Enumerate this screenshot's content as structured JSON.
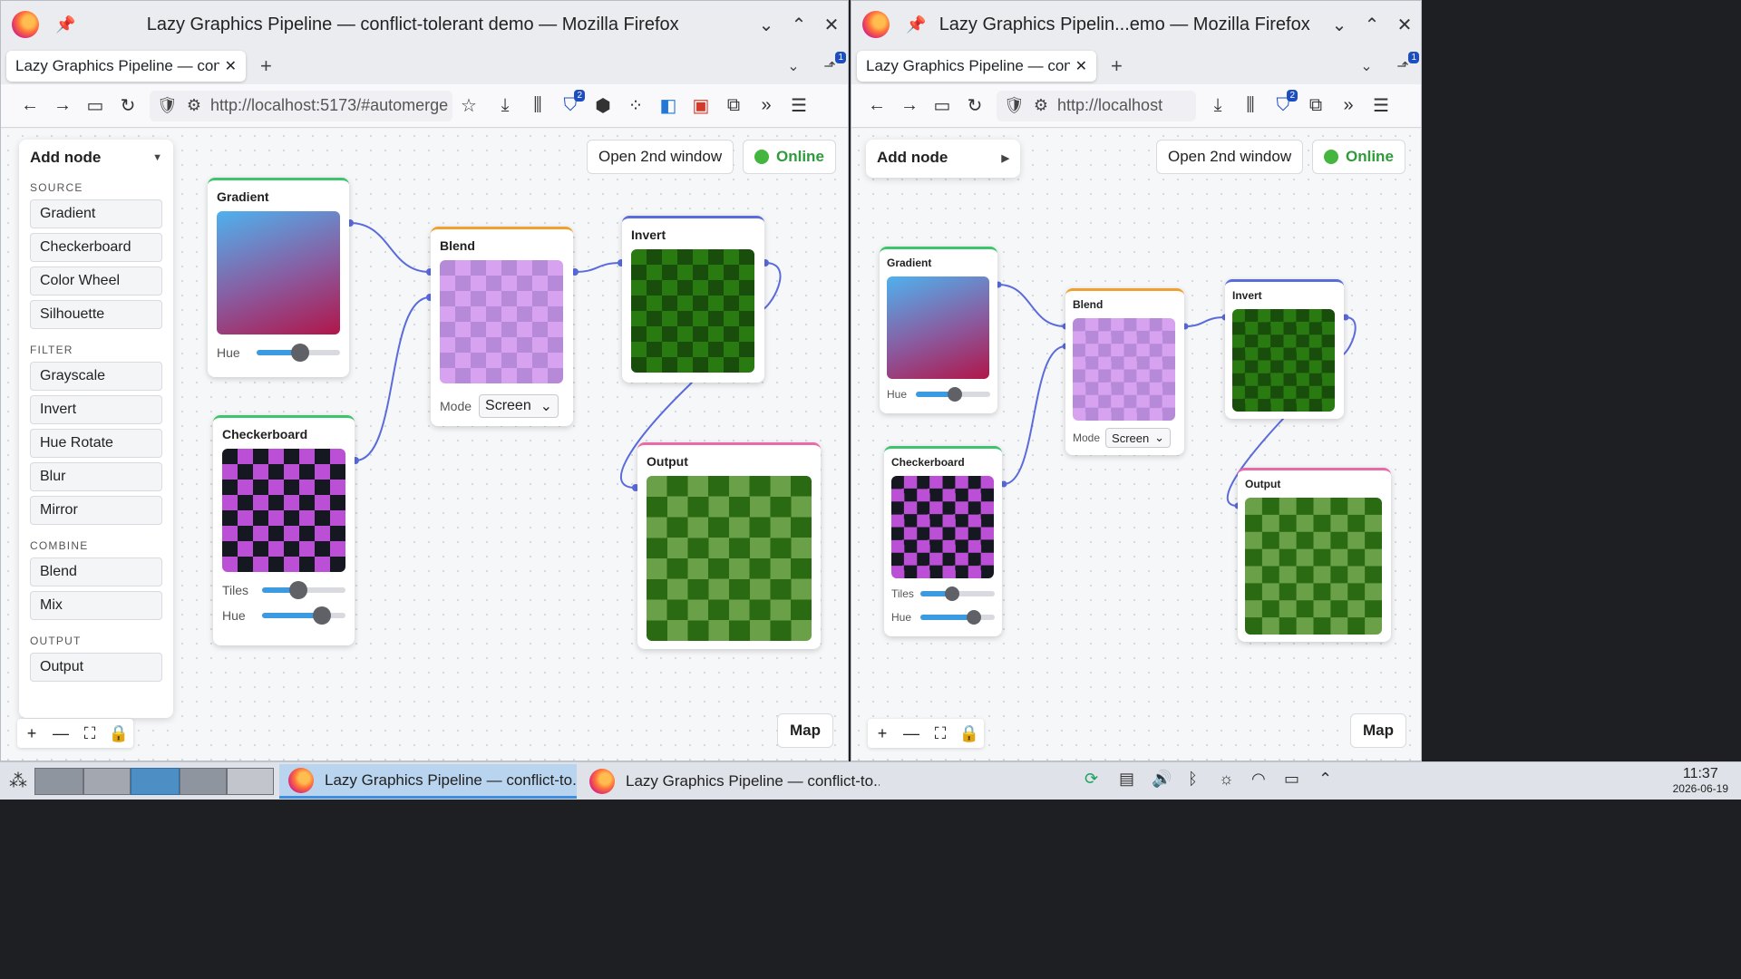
{
  "left_window": {
    "title": "Lazy Graphics Pipeline — conflict-tolerant demo — Mozilla Firefox",
    "tab_title": "Lazy Graphics Pipeline — confl",
    "url": "http://localhost:5173/#automerge",
    "tab_count_badge": "1",
    "extension_badge": "2",
    "add_node": {
      "header": "Add node",
      "sections": [
        {
          "title": "SOURCE",
          "items": [
            "Gradient",
            "Checkerboard",
            "Color Wheel",
            "Silhouette"
          ]
        },
        {
          "title": "FILTER",
          "items": [
            "Grayscale",
            "Invert",
            "Hue Rotate",
            "Blur",
            "Mirror"
          ]
        },
        {
          "title": "COMBINE",
          "items": [
            "Blend",
            "Mix"
          ]
        },
        {
          "title": "OUTPUT",
          "items": [
            "Output"
          ]
        }
      ]
    },
    "open_second_window": "Open 2nd window",
    "status": "Online",
    "map_button": "Map"
  },
  "right_window": {
    "title": "Lazy Graphics Pipelin...emo — Mozilla Firefox",
    "tab_title": "Lazy Graphics Pipeline — confl",
    "url": "http://localhost",
    "tab_count_badge": "1",
    "extension_badge": "2",
    "add_node_header": "Add node",
    "open_second_window": "Open 2nd window",
    "status": "Online",
    "map_button": "Map"
  },
  "nodes": {
    "gradient": {
      "title": "Gradient",
      "hue_label": "Hue",
      "hue": 0.52
    },
    "checkerboard": {
      "title": "Checkerboard",
      "tiles_label": "Tiles",
      "tiles": 0.43,
      "hue_label": "Hue",
      "hue": 0.72
    },
    "blend": {
      "title": "Blend",
      "mode_label": "Mode",
      "mode": "Screen"
    },
    "invert": {
      "title": "Invert"
    },
    "output": {
      "title": "Output"
    }
  },
  "colors": {
    "accent": "#5a6bdc",
    "source_border": "#3ec46d",
    "combine_border": "#f0a030",
    "filter_border": "#5a6bdc",
    "output_border": "#e86aa6",
    "online": "#2e9c3a"
  },
  "taskbar": {
    "apps": [
      "Lazy Graphics Pipeline — conflict-to...",
      "Lazy Graphics Pipeline — conflict-to..."
    ],
    "time": "11:37",
    "date": "2026-06-19"
  }
}
